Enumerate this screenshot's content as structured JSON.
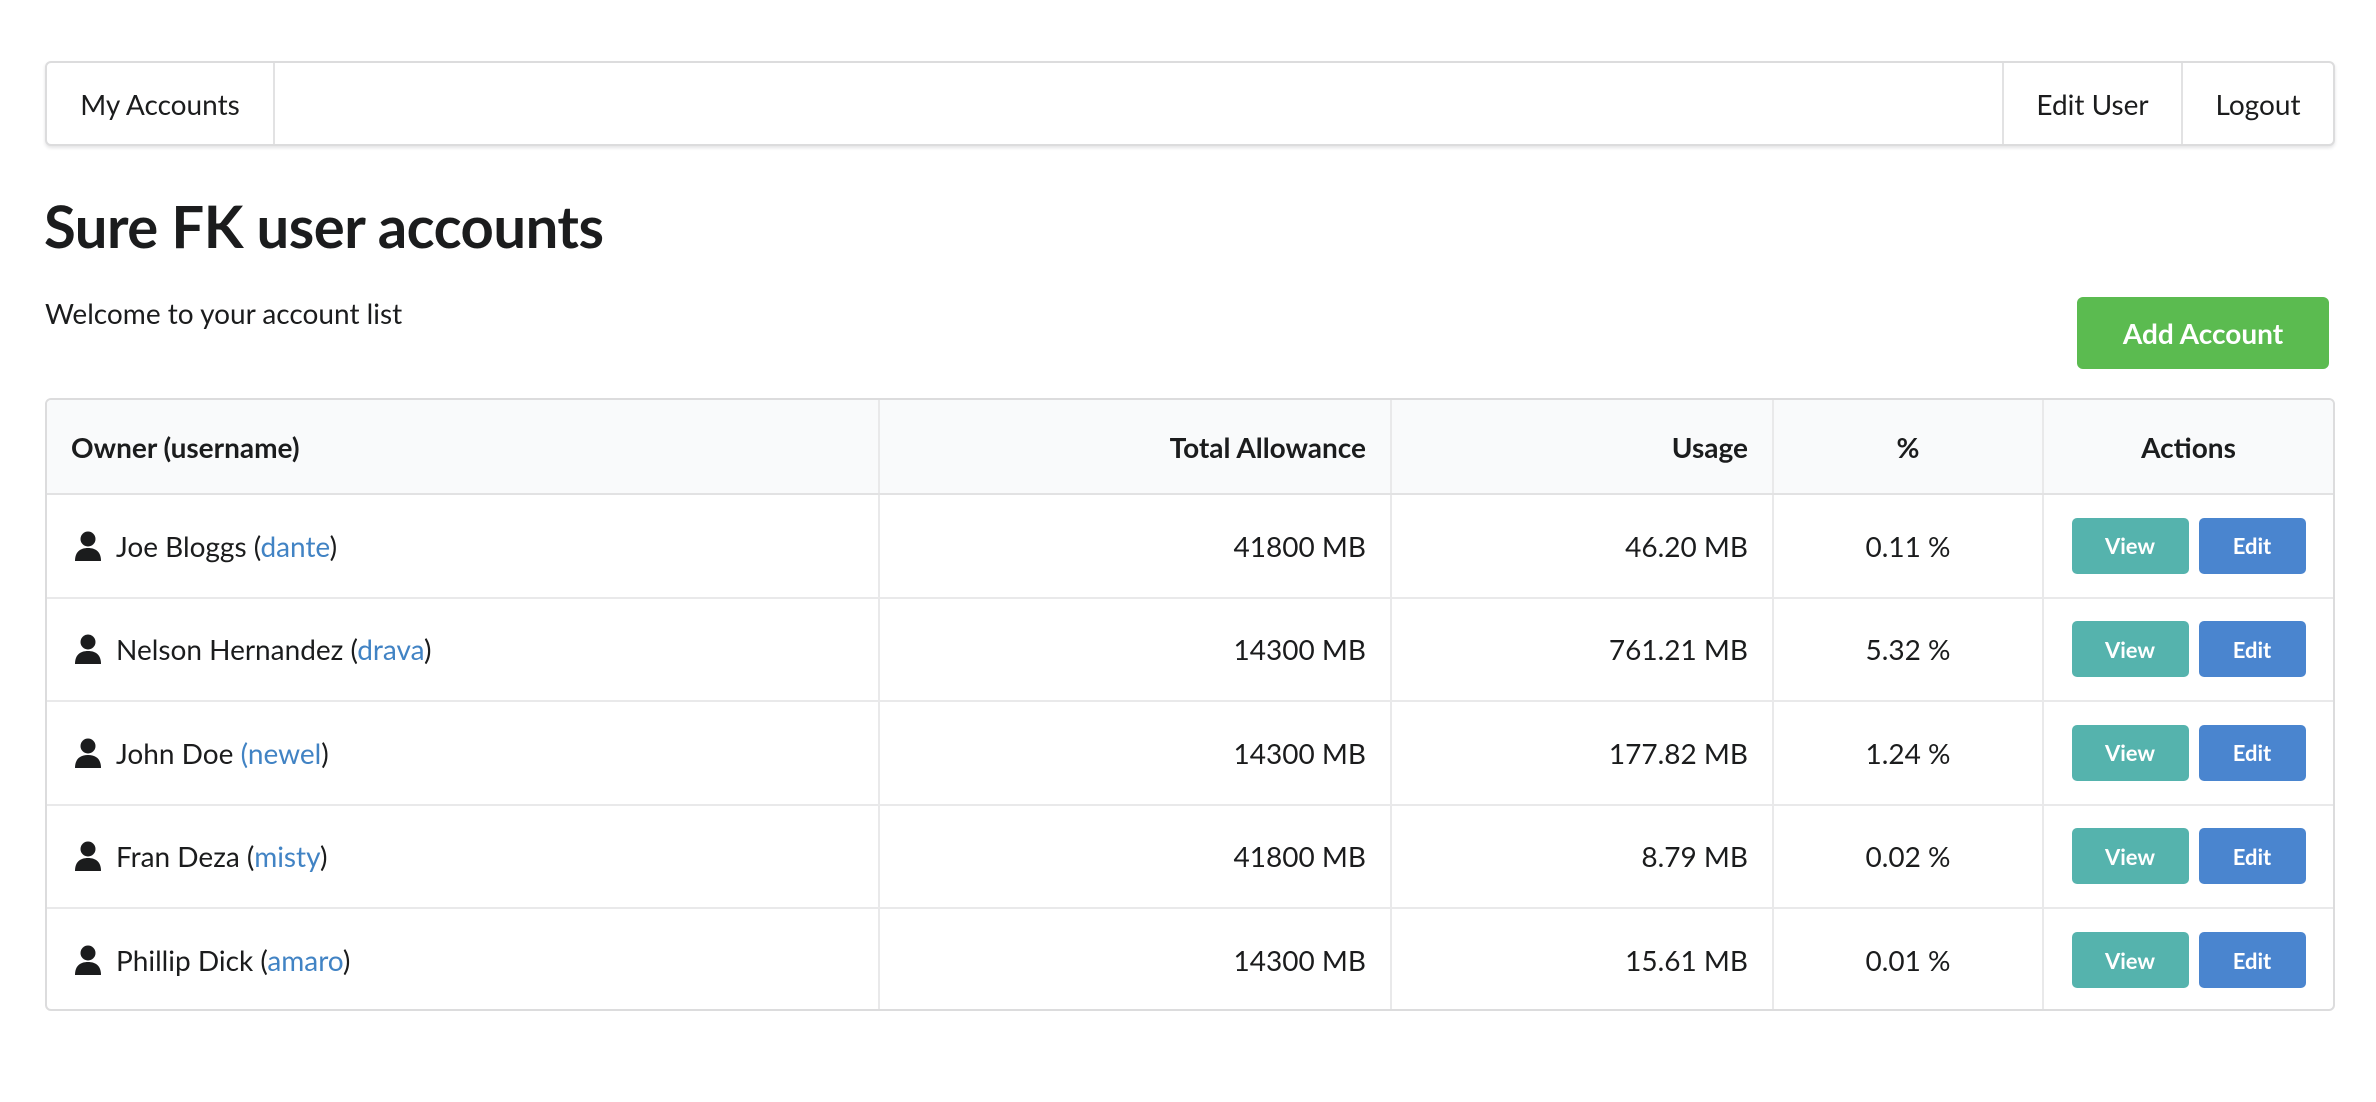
{
  "nav": {
    "my_accounts": "My Accounts",
    "edit_user": "Edit User",
    "logout": "Logout"
  },
  "page": {
    "title": "Sure FK user accounts",
    "subtitle": "Welcome to your account list",
    "add_button": "Add Account"
  },
  "table": {
    "headers": {
      "owner": "Owner (username)",
      "allowance": "Total Allowance",
      "usage": "Usage",
      "percent": "%",
      "actions": "Actions"
    },
    "rows": [
      {
        "name": "Joe Bloggs",
        "open": " (",
        "username": "dante",
        "close": ")",
        "allowance": "41800 MB",
        "usage": "46.20 MB",
        "percent": "0.11 %"
      },
      {
        "name": "Nelson Hernandez",
        "open": " (",
        "username": "drava",
        "close": ")",
        "allowance": "14300 MB",
        "usage": "761.21 MB",
        "percent": "5.32 %"
      },
      {
        "name": "John Doe",
        "open": " ",
        "username": "(newel",
        "close": ")",
        "allowance": "14300 MB",
        "usage": "177.82 MB",
        "percent": "1.24 %"
      },
      {
        "name": "Fran Deza",
        "open": " (",
        "username": "misty",
        "close": ")",
        "allowance": "41800 MB",
        "usage": "8.79 MB",
        "percent": "0.02 %"
      },
      {
        "name": "Phillip Dick",
        "open": " (",
        "username": "amaro",
        "close": ")",
        "allowance": "14300 MB",
        "usage": "15.61 MB",
        "percent": "0.01 %"
      }
    ],
    "view_label": "View",
    "edit_label": "Edit"
  },
  "colors": {
    "add_button": "#5bbb50",
    "view_button": "#55b3ad",
    "edit_button": "#4a85cf",
    "link": "#4183c4"
  }
}
